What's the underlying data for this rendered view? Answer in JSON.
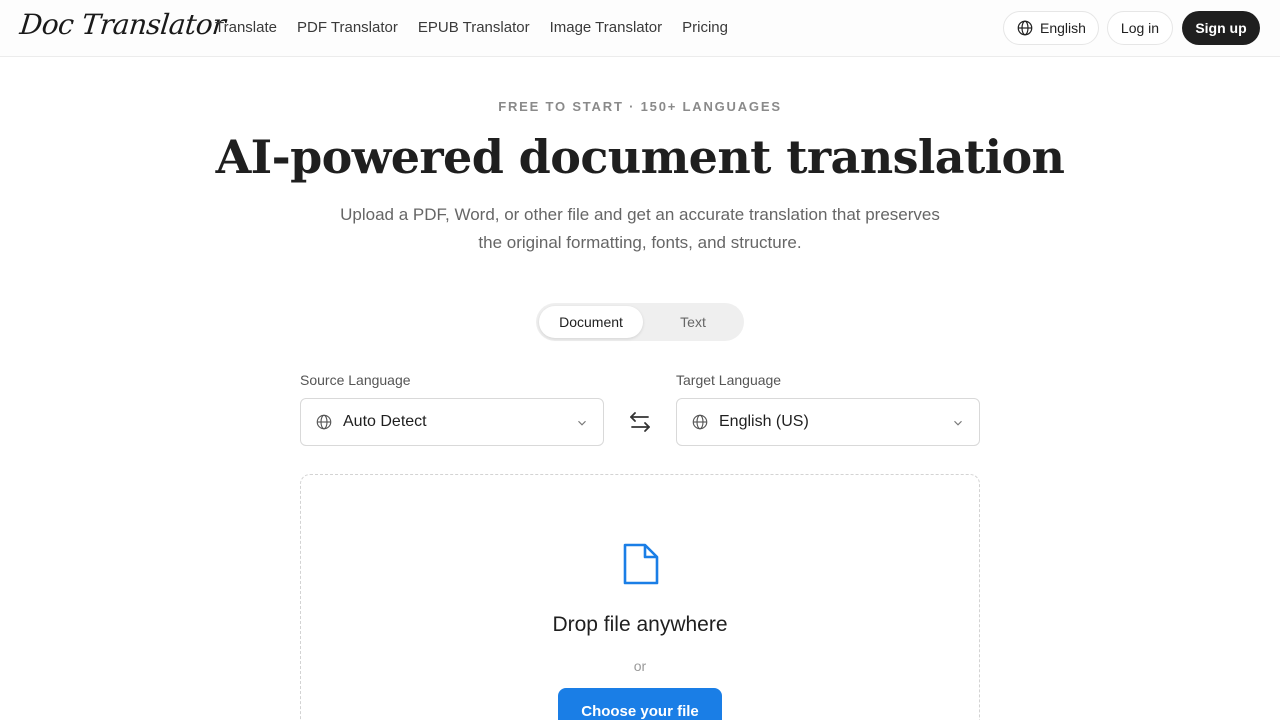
{
  "header": {
    "logo": "Doc Translator",
    "nav": [
      {
        "label": "Translate"
      },
      {
        "label": "PDF Translator"
      },
      {
        "label": "EPUB Translator"
      },
      {
        "label": "Image Translator"
      },
      {
        "label": "Pricing"
      }
    ],
    "language_button": "English",
    "login_label": "Log in",
    "signup_label": "Sign up"
  },
  "hero": {
    "eyebrow": "FREE TO START · 150+ LANGUAGES",
    "title": "AI-powered document translation",
    "subtitle": "Upload a PDF, Word, or other file and get an accurate translation that preserves the original formatting, fonts, and structure."
  },
  "mode_toggle": {
    "options": [
      "Document",
      "Text"
    ],
    "selected": "Document"
  },
  "languages": {
    "source_label": "Source Language",
    "source_value": "Auto Detect",
    "target_label": "Target Language",
    "target_value": "English (US)"
  },
  "dropzone": {
    "title": "Drop file anywhere",
    "or_text": "or",
    "button_label": "Choose your file"
  },
  "colors": {
    "accent": "#1a7ee6",
    "dark_button": "#1f1f1f"
  },
  "icons": [
    "globe-icon",
    "chevron-down-icon",
    "swap-icon",
    "file-icon"
  ]
}
